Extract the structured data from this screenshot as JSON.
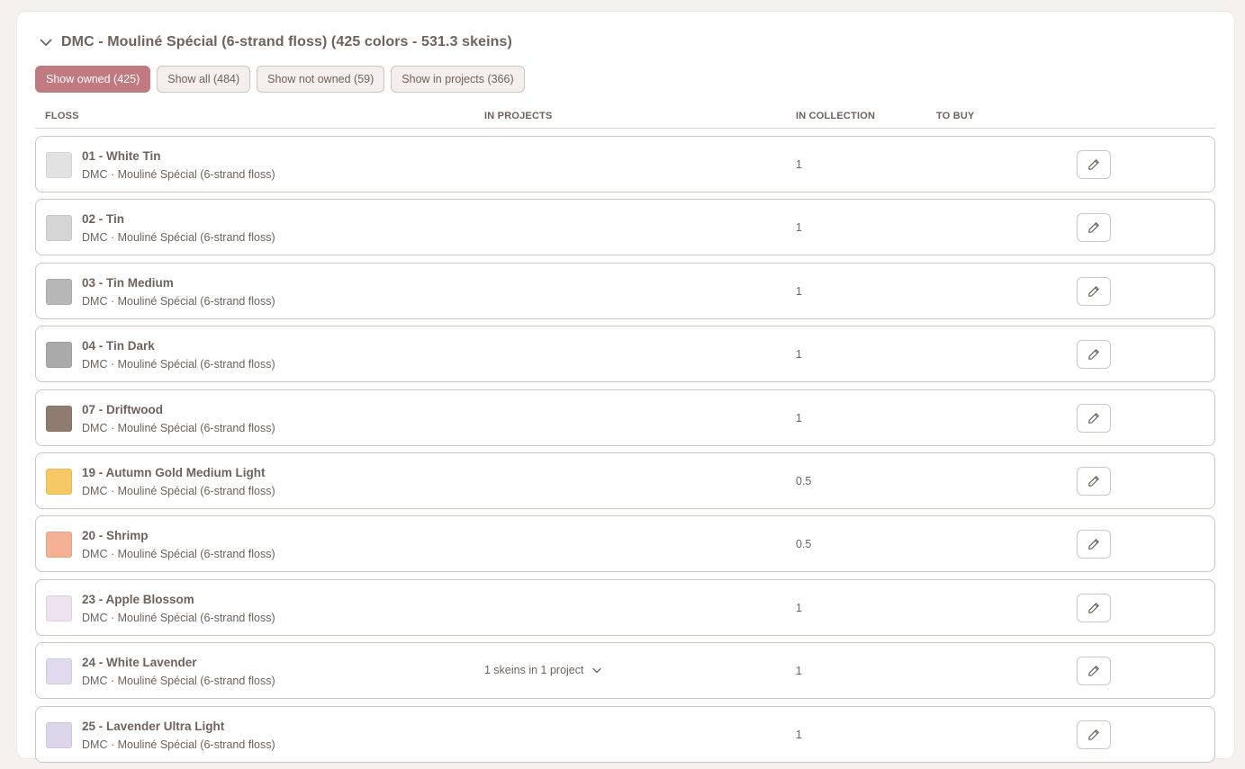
{
  "section": {
    "title": "DMC - Mouliné Spécial (6-strand floss) (425 colors - 531.3 skeins)",
    "icon": "chevron-down-icon"
  },
  "filters": [
    {
      "label": "Show owned (425)",
      "active": true
    },
    {
      "label": "Show all (484)",
      "active": false
    },
    {
      "label": "Show not owned (59)",
      "active": false
    },
    {
      "label": "Show in projects (366)",
      "active": false
    }
  ],
  "columns": {
    "floss": "FLOSS",
    "in_projects": "IN PROJECTS",
    "in_collection": "IN COLLECTION",
    "to_buy": "TO BUY"
  },
  "rows": [
    {
      "name": "01 - White Tin",
      "sub": "DMC · Mouliné Spécial (6-strand floss)",
      "color": "#e3e2e3",
      "in_projects": "",
      "in_collection": "1"
    },
    {
      "name": "02 - Tin",
      "sub": "DMC · Mouliné Spécial (6-strand floss)",
      "color": "#d6d5d6",
      "in_projects": "",
      "in_collection": "1"
    },
    {
      "name": "03 - Tin Medium",
      "sub": "DMC · Mouliné Spécial (6-strand floss)",
      "color": "#b8b7b8",
      "in_projects": "",
      "in_collection": "1"
    },
    {
      "name": "04 - Tin Dark",
      "sub": "DMC · Mouliné Spécial (6-strand floss)",
      "color": "#abaaab",
      "in_projects": "",
      "in_collection": "1"
    },
    {
      "name": "07 - Driftwood",
      "sub": "DMC · Mouliné Spécial (6-strand floss)",
      "color": "#8f7b6f",
      "in_projects": "",
      "in_collection": "1"
    },
    {
      "name": "19 - Autumn Gold Medium Light",
      "sub": "DMC · Mouliné Spécial (6-strand floss)",
      "color": "#f6c964",
      "in_projects": "",
      "in_collection": "0.5"
    },
    {
      "name": "20 - Shrimp",
      "sub": "DMC · Mouliné Spécial (6-strand floss)",
      "color": "#f4b196",
      "in_projects": "",
      "in_collection": "0.5"
    },
    {
      "name": "23 - Apple Blossom",
      "sub": "DMC · Mouliné Spécial (6-strand floss)",
      "color": "#ede2ed",
      "in_projects": "",
      "in_collection": "1"
    },
    {
      "name": "24 - White Lavender",
      "sub": "DMC · Mouliné Spécial (6-strand floss)",
      "color": "#e1d9ed",
      "in_projects": "1 skeins in 1 project",
      "in_collection": "1"
    },
    {
      "name": "25 - Lavender Ultra Light",
      "sub": "DMC · Mouliné Spécial (6-strand floss)",
      "color": "#dcd5ec",
      "in_projects": "",
      "in_collection": "1"
    }
  ],
  "icons": {
    "edit": "pencil-icon",
    "expand": "chevron-down-icon"
  }
}
